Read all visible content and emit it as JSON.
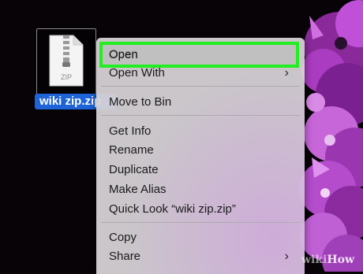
{
  "desktop": {
    "file_name": "wiki zip.zip",
    "file_badge": "ZIP"
  },
  "context_menu": {
    "items": [
      {
        "label": "Open",
        "has_submenu": false
      },
      {
        "label": "Open With",
        "has_submenu": true
      },
      {
        "label": "Move to Bin",
        "has_submenu": false
      },
      {
        "label": "Get Info",
        "has_submenu": false
      },
      {
        "label": "Rename",
        "has_submenu": false
      },
      {
        "label": "Duplicate",
        "has_submenu": false
      },
      {
        "label": "Make Alias",
        "has_submenu": false
      },
      {
        "label": "Quick Look “wiki zip.zip”",
        "has_submenu": false
      },
      {
        "label": "Copy",
        "has_submenu": false
      },
      {
        "label": "Share",
        "has_submenu": true
      }
    ],
    "submenu_glyph": "›"
  },
  "watermark": {
    "prefix": "wiki",
    "suffix": "How"
  },
  "colors": {
    "highlight_border": "#22ee22",
    "selection_blue": "#1e63d8",
    "flower": "#b040c8"
  }
}
